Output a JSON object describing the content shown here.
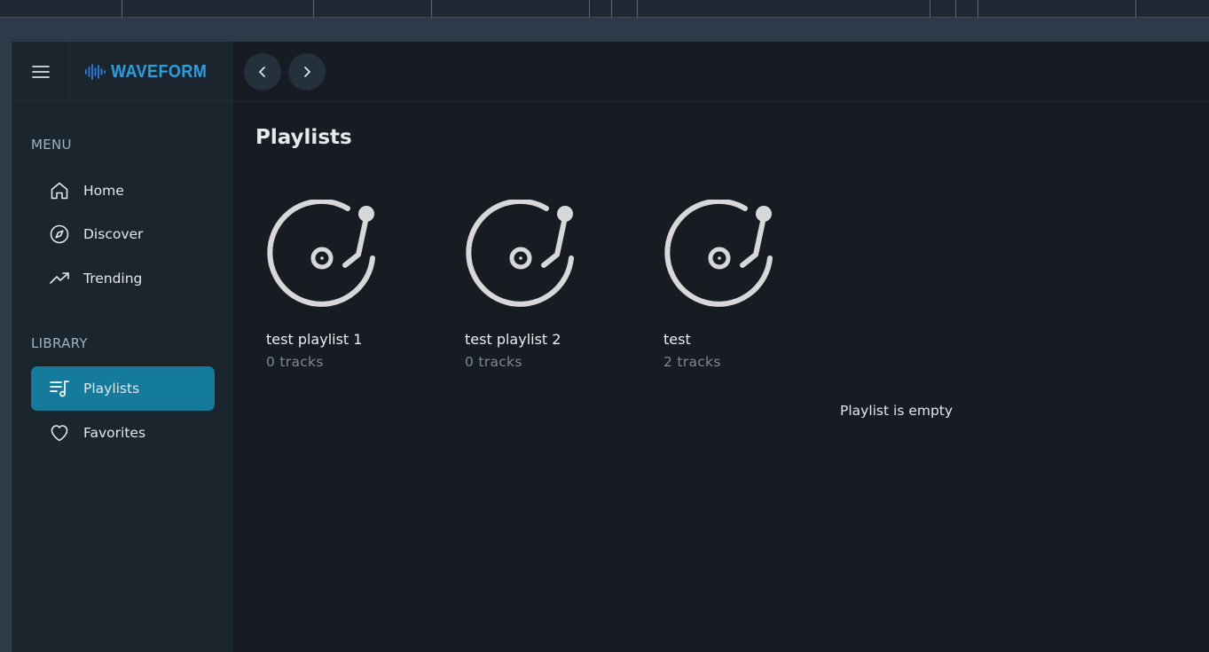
{
  "app": {
    "name": "WAVEFORM",
    "brand_color": "#2a9ee0",
    "accent_color": "#157b9d"
  },
  "sidebar": {
    "menu_label": "MENU",
    "menu_items": [
      {
        "label": "Home",
        "icon": "home-icon"
      },
      {
        "label": "Discover",
        "icon": "compass-icon"
      },
      {
        "label": "Trending",
        "icon": "trending-up-icon"
      }
    ],
    "library_label": "LIBRARY",
    "library_items": [
      {
        "label": "Playlists",
        "icon": "playlist-music-icon",
        "active": true
      },
      {
        "label": "Favorites",
        "icon": "heart-icon",
        "active": false
      }
    ]
  },
  "main": {
    "title": "Playlists",
    "playlists": [
      {
        "name": "test playlist 1",
        "tracks": "0 tracks",
        "icon": "turntable-icon"
      },
      {
        "name": "test playlist 2",
        "tracks": "0 tracks",
        "icon": "turntable-icon"
      },
      {
        "name": "test",
        "tracks": "2 tracks",
        "icon": "turntable-icon"
      }
    ],
    "empty_message": "Playlist is empty"
  }
}
